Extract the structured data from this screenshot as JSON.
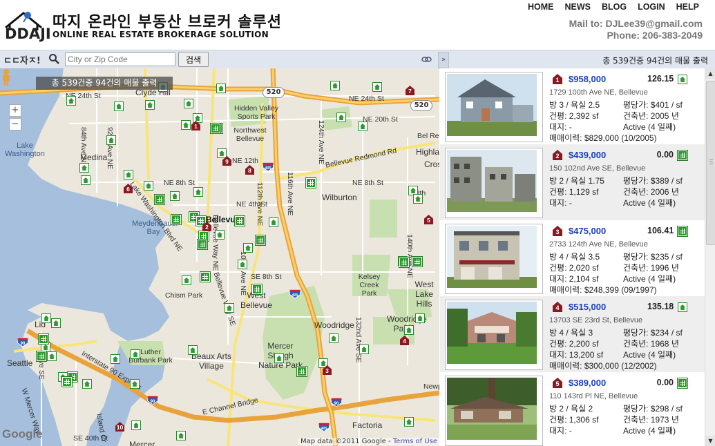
{
  "header": {
    "title": "따지 온라인 부동산 브로커 솔루션",
    "logo_text": "DDAJI",
    "subtitle": "ONLINE REAL ESTATE BROKERAGE SOLUTION",
    "nav": [
      "HOME",
      "NEWS",
      "BLOG",
      "LOGIN",
      "HELP"
    ],
    "mail": "Mail to: DJLee39@gmail.com",
    "phone": "Phone: 206-383-2049"
  },
  "toolbar": {
    "brand": "ㄷㄷ자ㅈ!",
    "search_placeholder": "City or Zip Code",
    "search_button": "검색",
    "collapse_glyph": "»",
    "summary": "총 539건중 94건의 매물 출력"
  },
  "map": {
    "badge": "총 539건중 94건의 매물 출력",
    "zoom_in": "+",
    "zoom_out": "−",
    "google_logo": "Google",
    "attribution": "Map data ©2011 Google -",
    "terms": "Terms of Use",
    "highways": [
      "520",
      "520",
      "405",
      "405",
      "90",
      "90"
    ],
    "interstate_labels": [
      "405",
      "405",
      "90",
      "90"
    ],
    "labels": [
      "Clyde Hill",
      "NE 24th St",
      "Hidden Valley Sports Park",
      "Northwest Bellevue",
      "NE 20th St",
      "NE 24th St",
      "Lake Washington",
      "Medina",
      "84th Ave NE",
      "92nd Ave NE",
      "Lake Washington Blvd NE",
      "NE 8th St",
      "NE 12th",
      "Bellevue",
      "NE 4th St",
      "Meydenbauer Bay",
      "NE 8th St",
      "Wilburton",
      "Bellevue Redmond Rd",
      "Bel Red",
      "Highla",
      "Cros",
      "124th Ave NE",
      "116th Ave NE",
      "112th Ave NE",
      "Bellevue Way NE",
      "108th Ave NE",
      "SE 8th St",
      "Chism Park",
      "West Bellevue",
      "Bellevue Way SE",
      "Kelsey Creek Park",
      "West Lake Hills",
      "140th Ave NE",
      "148th",
      "Woodridge",
      "Woodridge Park",
      "Mercer Slough Nature Park",
      "Beaux Arts Village",
      "Luther Burbank Park",
      "Interstate 90 Express",
      "E Channel Bridge",
      "W Mercer Way",
      "Factoria",
      "Island Cr",
      "SE 40th St",
      "Mercer",
      "Seattle",
      "Lid",
      "Ave SE",
      "132nd Ave SE",
      "Bellevue Way SE",
      "Newp"
    ]
  },
  "listings": [
    {
      "marker": "1",
      "price": "$958,000",
      "score": "126.15",
      "icon": "house-icon",
      "address": "1729 100th Ave NE, Bellevue",
      "rooms": "방 3 / 욕실 2.5",
      "area": "건평: 2,392 sf",
      "lot": "대지: -",
      "history": "매매이력: $829,000 (10/2005)",
      "ppsf": "평당가: $401 / sf",
      "built": "건축년: 2005 년",
      "status": "Active (4 일째)"
    },
    {
      "marker": "2",
      "price": "$439,000",
      "score": "0.00",
      "icon": "condo-icon",
      "address": "150 102nd Ave SE, Bellevue",
      "rooms": "방 2 / 욕실 1.75",
      "area": "건평: 1,129 sf",
      "lot": "대지: -",
      "history": "",
      "ppsf": "평당가: $389 / sf",
      "built": "건축년: 2006 년",
      "status": "Active (4 일째)"
    },
    {
      "marker": "3",
      "price": "$475,000",
      "score": "106.41",
      "icon": "condo-icon",
      "address": "2733 124th Ave NE, Bellevue",
      "rooms": "방 4 / 욕실 3.5",
      "area": "건평: 2,020 sf",
      "lot": "대지: 2,104 sf",
      "history": "매매이력: $248,399 (09/1997)",
      "ppsf": "평당가: $235 / sf",
      "built": "건축년: 1996 년",
      "status": "Active (4 일째)"
    },
    {
      "marker": "4",
      "price": "$515,000",
      "score": "135.18",
      "icon": "house-icon",
      "address": "13703 SE 23rd St, Bellevue",
      "rooms": "방 4 / 욕실 3",
      "area": "건평: 2,200 sf",
      "lot": "대지: 13,200 sf",
      "history": "매매이력: $300,000 (12/2002)",
      "ppsf": "평당가: $234 / sf",
      "built": "건축년: 1968 년",
      "status": "Active (4 일째)"
    },
    {
      "marker": "5",
      "price": "$389,000",
      "score": "0.00",
      "icon": "condo-icon",
      "address": "110 143rd Pl NE, Bellevue",
      "rooms": "방 2 / 욕실 2",
      "area": "건평: 1,306 sf",
      "lot": "대지: -",
      "history": "",
      "ppsf": "평당가: $298 / sf",
      "built": "건축년: 1973 년",
      "status": "Active (4 일째)"
    }
  ],
  "colors": {
    "price": "#1a3dbf",
    "marker": "#8a1a22",
    "pin_green": "#2c9a2c",
    "toolbar": "#dfe6ef",
    "water": "#a5bfdd"
  }
}
